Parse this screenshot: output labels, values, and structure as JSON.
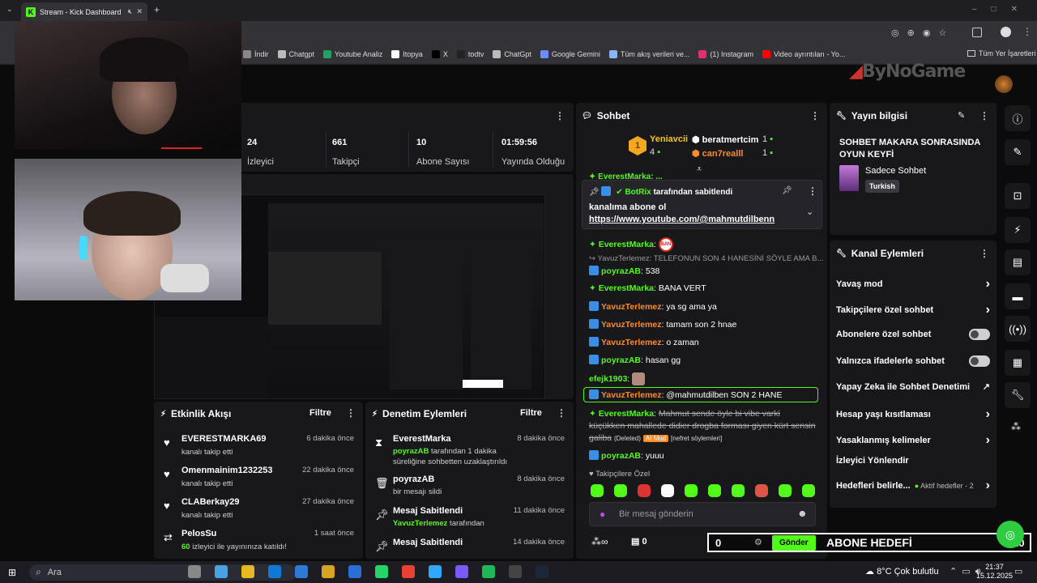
{
  "browser": {
    "tab_title": "Stream - Kick Dashboard",
    "bookmarks": [
      {
        "label": "İndir",
        "color": "#888"
      },
      {
        "label": "Chatgpt",
        "color": "#bbb"
      },
      {
        "label": "Youtube Analiz",
        "color": "#1fa463"
      },
      {
        "label": "Itopya",
        "color": "#fff"
      },
      {
        "label": "X",
        "color": "#000"
      },
      {
        "label": "todtv",
        "color": "#222"
      },
      {
        "label": "ChatGpt",
        "color": "#bbb"
      },
      {
        "label": "Google Gemini",
        "color": "#6a8cff"
      },
      {
        "label": "Tüm akış verileri ve...",
        "color": "#8ab4f8"
      },
      {
        "label": "(1) Instagram",
        "color": "#e1306c"
      },
      {
        "label": "Video ayrıntıları - Yo...",
        "color": "#ff0000"
      }
    ],
    "all_bookmarks": "Tüm Yer İşaretleri"
  },
  "header": {
    "logo_text": "ByNoGame"
  },
  "stats": {
    "viewers": {
      "value": "24",
      "label": "İzleyici"
    },
    "followers": {
      "value": "661",
      "label": "Takipçi"
    },
    "subscribers": {
      "value": "10",
      "label": "Abone Sayısı"
    },
    "uptime": {
      "value": "01:59:56",
      "label": "Yayında Olduğu"
    }
  },
  "event_feed": {
    "title": "Etkinlik Akışı",
    "filter": "Filtre",
    "items": [
      {
        "name": "EVERESTMARKA69",
        "sub": "kanalı takip etti",
        "time": "6 dakika önce",
        "icon": "heart-icon"
      },
      {
        "name": "Omenmainim1232253",
        "sub": "kanalı takip etti",
        "time": "22 dakika önce",
        "icon": "heart-icon"
      },
      {
        "name": "CLABerkay29",
        "sub": "kanalı takip etti",
        "time": "27 dakika önce",
        "icon": "heart-icon"
      },
      {
        "name": "PelosSu",
        "sub_highlight": "60",
        "sub": " izleyici ile yayınınıza katıldı!",
        "time": "1 saat önce",
        "icon": "raid-icon"
      }
    ]
  },
  "mod_actions": {
    "title": "Denetim Eylemleri",
    "filter": "Filtre",
    "items": [
      {
        "name": "EverestMarka",
        "actor": "poyrazAB",
        "sub": " tarafından 1 dakika süreliğine sohbetten uzaklaştırıldı",
        "time": "8 dakika önce",
        "icon": "hourglass-icon"
      },
      {
        "name": "poyrazAB",
        "actor": "",
        "sub": "bir mesajı sildi",
        "time": "8 dakika önce",
        "icon": "trash-icon"
      },
      {
        "name": "Mesaj Sabitlendi",
        "actor": "YavuzTerlemez",
        "sub": " tarafından",
        "time": "11 dakika önce",
        "icon": "pin-icon"
      },
      {
        "name": "Mesaj Sabitlendi",
        "actor": "",
        "sub": "",
        "time": "14 dakika önce",
        "icon": "pin-icon"
      }
    ]
  },
  "chat": {
    "title": "Sohbet",
    "leaderboard": {
      "first": {
        "name": "Yeniavcii",
        "count": "4"
      },
      "second": {
        "name": "beratmertcim",
        "count": "1"
      },
      "third": {
        "name": "can7realll",
        "count": "1"
      }
    },
    "pinned": {
      "by_user": "BotRix",
      "by_suffix": " tarafından sabitlendi",
      "text": "kanalıma abone ol",
      "link": "https://www.youtube.com/@mahmutdilbenn"
    },
    "messages": [
      {
        "user": "EverestMarka",
        "text": "",
        "color": "green",
        "badge": "ban"
      },
      {
        "reply": "YavuzTerlemez: TELEFONUN SON 4 HANESİNİ SÖYLE AMA B..."
      },
      {
        "user": "poyrazAB",
        "text": "538",
        "color": "green"
      },
      {
        "user": "EverestMarka",
        "text": "BANA VERT",
        "color": "green"
      },
      {
        "user": "YavuzTerlemez",
        "text": "ya sg ama ya",
        "color": "orange"
      },
      {
        "user": "YavuzTerlemez",
        "text": "tamam son 2 hnae",
        "color": "orange"
      },
      {
        "user": "YavuzTerlemez",
        "text": "o zaman",
        "color": "orange"
      },
      {
        "user": "poyrazAB",
        "text": "hasan gg",
        "color": "green"
      },
      {
        "user": "efejk1903",
        "text": "",
        "color": "green"
      },
      {
        "user": "YavuzTerlemez",
        "text": "@mahmutdilben SON 2 HANE",
        "color": "orange",
        "highlight": true
      }
    ],
    "deleted": {
      "user": "EverestMarka",
      "text": "Mahmut sende öyle bi vibe varki küçükken mahallede didier drogba forması giyen kürt sensin galiba",
      "deleted_label": "(Deleted)",
      "ai_mod": "AI Mod",
      "reason": "[nefret söylemleri]"
    },
    "last": {
      "user": "poyrazAB",
      "text": "yuuu"
    },
    "followers_only": "Takipçilere Özel",
    "input_placeholder": "Bir mesaj gönderin",
    "footer_count": "0",
    "goal_value": "0",
    "send": "Gönder",
    "goal_label": "ABONE HEDEFİ",
    "goal_number": "10"
  },
  "stream_info": {
    "title": "Yayın bilgisi",
    "stream_title": "SOHBET MAKARA SONRASINDA OYUN KEYFİ",
    "category": "Sadece Sohbet",
    "language": "Turkish"
  },
  "channel_actions": {
    "title": "Kanal Eylemleri",
    "items": [
      {
        "label": "Yavaş mod",
        "control": "chevron"
      },
      {
        "label": "Takipçilere özel sohbet",
        "control": "chevron"
      },
      {
        "label": "Abonelere özel sohbet",
        "control": "toggle"
      },
      {
        "label": "Yalnızca ifadelerle sohbet",
        "control": "toggle"
      },
      {
        "label": "Yapay Zeka ile Sohbet Denetimi",
        "control": "external"
      },
      {
        "label": "Hesap yaşı kısıtlaması",
        "control": "chevron"
      },
      {
        "label": "Yasaklanmış kelimeler",
        "control": "chevron"
      },
      {
        "label": "İzleyici Yönlendir",
        "control": "none"
      },
      {
        "label": "Hedefleri belirle...",
        "control": "chevron",
        "extra": "Aktif hedefler - 2"
      }
    ]
  },
  "taskbar": {
    "search": "Ara",
    "weather": "8°C  Çok bulutlu",
    "time": "21:37",
    "date": "15.12.2025"
  }
}
